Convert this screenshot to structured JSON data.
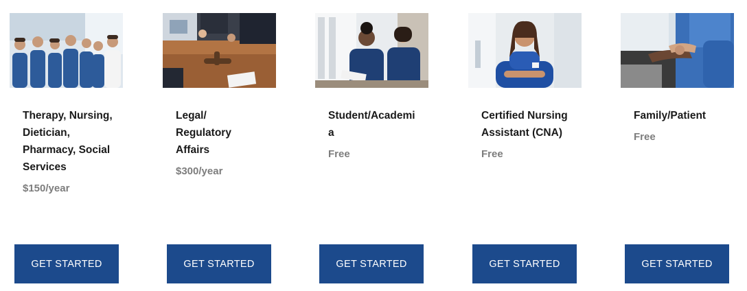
{
  "plans": [
    {
      "image": "healthcare-team-photo",
      "title": "Therapy, Nursing, Dietician, Pharmacy, Social Services",
      "price": "$150/year",
      "button_label": "GET STARTED"
    },
    {
      "image": "legal-meeting-photo",
      "title": "Legal/ Regulatory Affairs",
      "price": "$300/year",
      "button_label": "GET STARTED"
    },
    {
      "image": "students-studying-photo",
      "title": "Student/Academia",
      "price": "Free",
      "button_label": "GET STARTED"
    },
    {
      "image": "nursing-assistant-photo",
      "title": "Certified Nursing Assistant (CNA)",
      "price": "Free",
      "button_label": "GET STARTED"
    },
    {
      "image": "caregiver-patient-photo",
      "title": "Family/Patient",
      "price": "Free",
      "button_label": "GET STARTED"
    }
  ],
  "colors": {
    "button_bg": "#1c4a8c",
    "button_text": "#ffffff",
    "title_text": "#1a1a1a",
    "price_text": "#7d7d7d"
  }
}
